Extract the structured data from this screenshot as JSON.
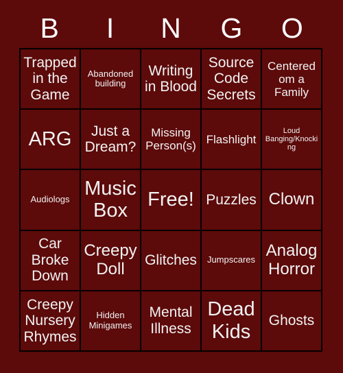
{
  "card": {
    "header_letters": [
      "B",
      "I",
      "N",
      "G",
      "O"
    ],
    "rows": [
      [
        {
          "label": "Trapped in the Game",
          "size": "md"
        },
        {
          "label": "Abandoned building",
          "size": "xs"
        },
        {
          "label": "Writing in Blood",
          "size": "md"
        },
        {
          "label": "Source Code Secrets",
          "size": "md"
        },
        {
          "label": "Centered om a Family",
          "size": "sm"
        }
      ],
      [
        {
          "label": "ARG",
          "size": "xl"
        },
        {
          "label": "Just a Dream?",
          "size": "md"
        },
        {
          "label": "Missing Person(s)",
          "size": "sm"
        },
        {
          "label": "Flashlight",
          "size": "sm"
        },
        {
          "label": "Loud Banging/Knocking",
          "size": "xxs"
        }
      ],
      [
        {
          "label": "Audiologs",
          "size": "xs"
        },
        {
          "label": "Music Box",
          "size": "xl"
        },
        {
          "label": "Free!",
          "size": "xl"
        },
        {
          "label": "Puzzles",
          "size": "md"
        },
        {
          "label": "Clown",
          "size": "lg"
        }
      ],
      [
        {
          "label": "Car Broke Down",
          "size": "md"
        },
        {
          "label": "Creepy Doll",
          "size": "lg"
        },
        {
          "label": "Glitches",
          "size": "md"
        },
        {
          "label": "Jumpscares",
          "size": "xs"
        },
        {
          "label": "Analog Horror",
          "size": "lg"
        }
      ],
      [
        {
          "label": "Creepy Nursery Rhymes",
          "size": "md"
        },
        {
          "label": "Hidden Minigames",
          "size": "xs"
        },
        {
          "label": "Mental Illness",
          "size": "md"
        },
        {
          "label": "Dead Kids",
          "size": "xl"
        },
        {
          "label": "Ghosts",
          "size": "md"
        }
      ]
    ]
  },
  "colors": {
    "background": "#5c0a0a",
    "cell_background": "#5c0a0a",
    "grid_line": "#050000",
    "text": "#f2f2f2",
    "header_text": "#ffffff"
  }
}
